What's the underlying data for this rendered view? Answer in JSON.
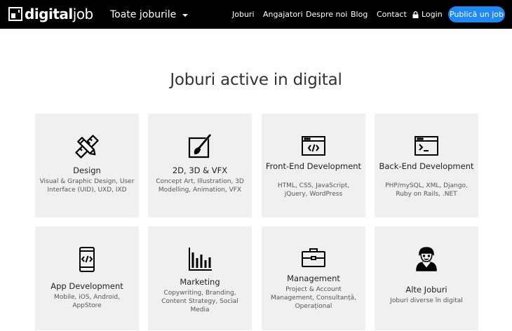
{
  "header": {
    "logo": {
      "bold": "digital",
      "light": "job"
    },
    "jobs_dropdown": "Toate joburile",
    "nav": [
      "Joburi",
      "Angajatori",
      "Despre noi",
      "Blog",
      "Contact"
    ],
    "login": "Login",
    "publish": "Publică un job"
  },
  "main": {
    "title": "Joburi active in digital",
    "categories": [
      {
        "name": "Design",
        "desc": "Visual & Graphic Design, User Interface (UID), UXD, IXD",
        "icon": "design-tools-icon"
      },
      {
        "name": "2D, 3D & VFX",
        "desc": "Concept Art, Illustration, 3D Modelling, Animation, VFX",
        "icon": "brush-canvas-icon"
      },
      {
        "name": "Front-End Development",
        "desc": "HTML, CSS, JavaScript, jQuery, WordPress",
        "icon": "code-window-icon"
      },
      {
        "name": "Back-End Development",
        "desc": "PHP/mySQL, XML, Django, Ruby on Rails, .NET",
        "icon": "terminal-window-icon"
      },
      {
        "name": "App Development",
        "desc": "Mobile, iOS, Android, AppStore",
        "icon": "mobile-code-icon"
      },
      {
        "name": "Marketing",
        "desc": "Copywriting, Branding, Content Strategy, Social Media",
        "icon": "bar-chart-icon"
      },
      {
        "name": "Management",
        "desc": "Project & Account Management, Consultanță, Operațional",
        "icon": "briefcase-icon"
      },
      {
        "name": "Alte Joburi",
        "desc": "Joburi diverse în digital",
        "icon": "person-icon"
      }
    ]
  },
  "colors": {
    "nav_bg": "#000000",
    "accent": "#1e88f4",
    "card_bg": "#f0f0f0"
  }
}
